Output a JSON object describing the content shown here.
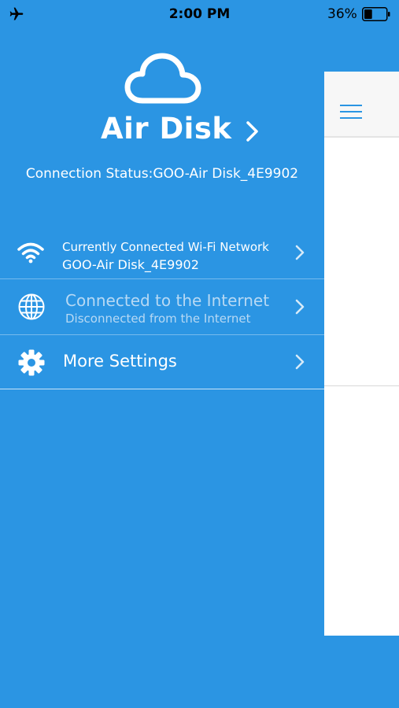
{
  "status_bar": {
    "time": "2:00 PM",
    "battery_percent": "36%",
    "battery_level": 0.36,
    "airplane_icon": "airplane-icon",
    "battery_icon": "battery-icon"
  },
  "drawer": {
    "logo_icon": "cloud-icon",
    "app_title": "Air Disk",
    "connection_status": "Connection Status:GOO-Air Disk_4E9902",
    "items": [
      {
        "icon": "wifi-icon",
        "line1": "Currently Connected Wi-Fi Network",
        "line2": "GOO-Air Disk_4E9902"
      },
      {
        "icon": "globe-icon",
        "line1": "Connected to the Internet",
        "line2": "Disconnected from the Internet"
      },
      {
        "icon": "gear-icon",
        "line1": "More Settings"
      }
    ]
  },
  "main": {
    "menu_icon": "hamburger-menu-icon"
  },
  "colors": {
    "accent": "#2b95e3",
    "disabled_text": "#b7d9f4"
  }
}
